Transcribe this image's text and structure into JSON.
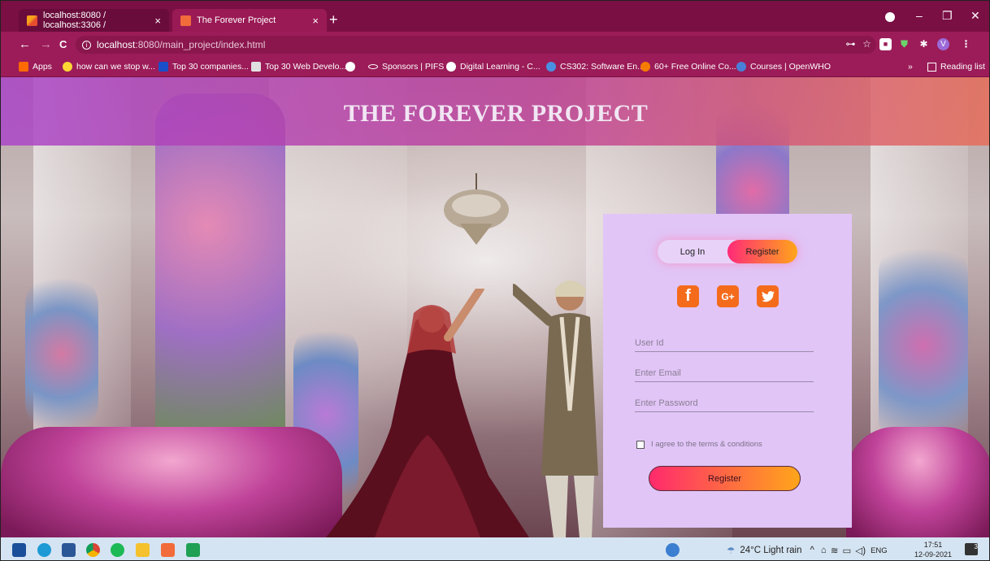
{
  "browser": {
    "tabs": [
      {
        "title": "localhost:8080 / localhost:3306 /",
        "close": "×"
      },
      {
        "title": "The Forever Project",
        "close": "×"
      }
    ],
    "new_tab": "+",
    "window_controls": {
      "minimize": "–",
      "restore": "❐",
      "close": "✕"
    },
    "nav": {
      "back": "←",
      "forward": "→",
      "reload": "C"
    },
    "url_host": "localhost",
    "url_path": ":8080/main_project/index.html",
    "profile_initial": "V",
    "toolbar_menu": "⋮"
  },
  "bookmarks": [
    {
      "label": "Apps",
      "color": "#ff6a00"
    },
    {
      "label": "how can we stop w...",
      "color": "#fdd835"
    },
    {
      "label": "Top 30 companies...",
      "color": "#1a4fc9"
    },
    {
      "label": "Top 30 Web Develo...",
      "color": "#e0e0e0"
    },
    {
      "label": "",
      "color": "#ffffff"
    },
    {
      "label": "Sponsors | PIFS",
      "color": "#ffffff"
    },
    {
      "label": "Digital Learning - C...",
      "color": "#ffffff"
    },
    {
      "label": "CS302: Software En...",
      "color": "#4a90e2"
    },
    {
      "label": "60+ Free Online Co...",
      "color": "#f57c00"
    },
    {
      "label": "Courses | OpenWHO",
      "color": "#4a7fd9"
    }
  ],
  "bookmarks_more": "»",
  "reading_list": "Reading list",
  "page": {
    "title": "THE FOREVER PROJECT"
  },
  "form": {
    "tab_login": "Log In",
    "tab_register": "Register",
    "social": [
      {
        "icon": "facebook-icon",
        "glyph": "f"
      },
      {
        "icon": "google-plus-icon",
        "glyph": "G+"
      },
      {
        "icon": "twitter-icon",
        "glyph": "🐦"
      }
    ],
    "user_id_placeholder": "User Id",
    "email_placeholder": "Enter Email",
    "password_placeholder": "Enter Password",
    "terms_label": "I agree to the terms & conditions",
    "submit_label": "Register"
  },
  "taskbar": {
    "weather": "24°C  Light rain",
    "lang": "ENG",
    "time": "17:51",
    "date": "12-09-2021",
    "notifications": "3"
  },
  "colors": {
    "browser_frame": "#9b1c58",
    "card_bg": "#e1c5f7",
    "accent_start": "#ff2a78",
    "accent_end": "#ffa51a",
    "social_icon": "#f46b1b"
  }
}
